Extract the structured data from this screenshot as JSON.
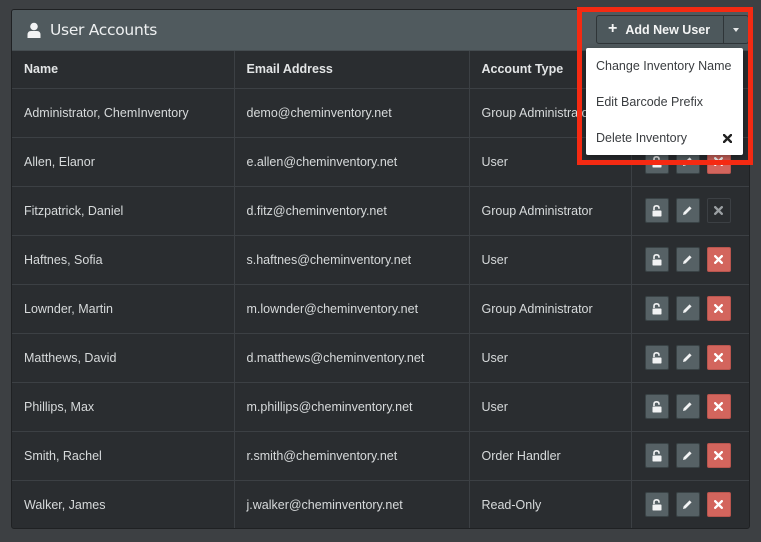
{
  "panel": {
    "title": "User Accounts",
    "icon": "user-icon",
    "add_button_label": "Add New User",
    "add_button_icon": "plus-icon"
  },
  "table": {
    "columns": [
      "Name",
      "Email Address",
      "Account Type",
      ""
    ],
    "rows": [
      {
        "name": "Administrator, ChemInventory",
        "email": "demo@cheminventory.net",
        "type": "Group Administrator",
        "delete_enabled": true
      },
      {
        "name": "Allen, Elanor",
        "email": "e.allen@cheminventory.net",
        "type": "User",
        "delete_enabled": true
      },
      {
        "name": "Fitzpatrick, Daniel",
        "email": "d.fitz@cheminventory.net",
        "type": "Group Administrator",
        "delete_enabled": false
      },
      {
        "name": "Haftnes, Sofia",
        "email": "s.haftnes@cheminventory.net",
        "type": "User",
        "delete_enabled": true
      },
      {
        "name": "Lownder, Martin",
        "email": "m.lownder@cheminventory.net",
        "type": "Group Administrator",
        "delete_enabled": true
      },
      {
        "name": "Matthews, David",
        "email": "d.matthews@cheminventory.net",
        "type": "User",
        "delete_enabled": true
      },
      {
        "name": "Phillips, Max",
        "email": "m.phillips@cheminventory.net",
        "type": "User",
        "delete_enabled": true
      },
      {
        "name": "Smith, Rachel",
        "email": "r.smith@cheminventory.net",
        "type": "Order Handler",
        "delete_enabled": true
      },
      {
        "name": "Walker, James",
        "email": "j.walker@cheminventory.net",
        "type": "Read-Only",
        "delete_enabled": true
      }
    ],
    "row_actions": [
      "unlock-icon",
      "pencil-icon",
      "delete-icon"
    ]
  },
  "dropdown": {
    "items": [
      {
        "label": "Change Inventory Name"
      },
      {
        "label": "Edit Barcode Prefix"
      },
      {
        "label": "Delete Inventory",
        "icon": "close-icon"
      }
    ]
  },
  "colors": {
    "highlight": "#f52a12",
    "delete": "#d3655d",
    "header": "#505a5e",
    "background": "#2a2d30"
  }
}
